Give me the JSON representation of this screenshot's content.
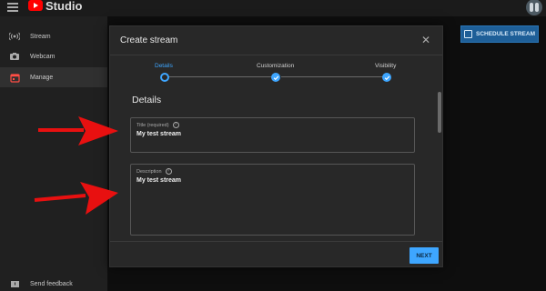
{
  "header": {
    "brand": "Studio",
    "icons": [
      "menu-icon",
      "youtube-logo-icon",
      "avatar-icon"
    ]
  },
  "sidebar": {
    "items": [
      {
        "label": "Stream",
        "icon": "stream-icon"
      },
      {
        "label": "Webcam",
        "icon": "camera-icon"
      },
      {
        "label": "Manage",
        "icon": "calendar-icon"
      }
    ],
    "feedback": "Send feedback"
  },
  "schedule_button": "SCHEDULE STREAM",
  "modal": {
    "title": "Create stream",
    "steps": [
      {
        "label": "Details",
        "state": "current"
      },
      {
        "label": "Customization",
        "state": "done"
      },
      {
        "label": "Visibility",
        "state": "done"
      }
    ],
    "section_title": "Details",
    "title_field": {
      "label": "Title (required)",
      "value": "My test stream"
    },
    "description_field": {
      "label": "Description",
      "value": "My test stream"
    },
    "next_label": "NEXT"
  },
  "colors": {
    "accent": "#3ea6ff",
    "annotation_arrow": "#e81010",
    "youtube_red": "#ff0000"
  }
}
